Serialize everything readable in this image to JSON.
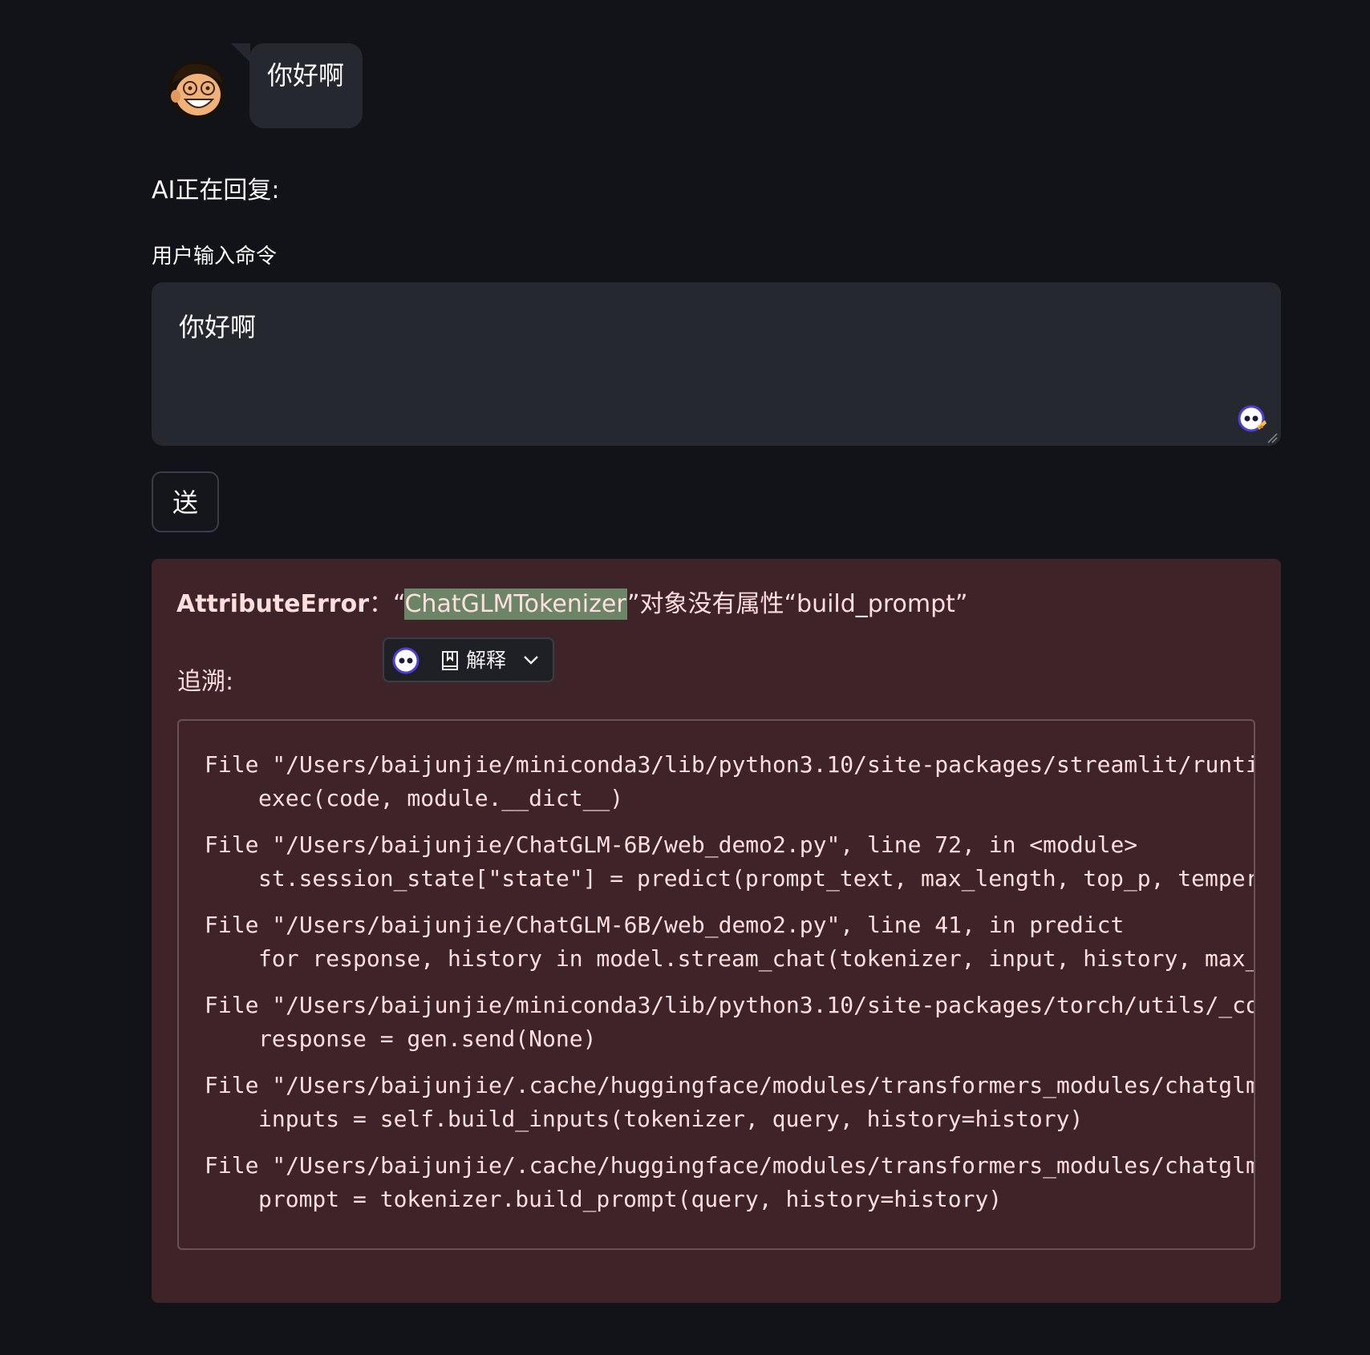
{
  "chat": {
    "user_message": "你好啊"
  },
  "status": {
    "text": "AI正在回复:"
  },
  "input": {
    "label": "用户输入命令",
    "value": "你好啊"
  },
  "send_button": {
    "label": "送"
  },
  "error": {
    "type": "AttributeError",
    "separator": "：“",
    "highlighted_term": "ChatGLMTokenizer",
    "message_rest": "”对象没有属性“build_prompt”",
    "traceback_label": "追溯:",
    "frames": [
      {
        "file_line": "File \"/Users/baijunjie/miniconda3/lib/python3.10/site-packages/streamlit/runti",
        "code": "exec(code, module.__dict__)"
      },
      {
        "file_line": "File \"/Users/baijunjie/ChatGLM-6B/web_demo2.py\", line 72, in <module>",
        "code": "st.session_state[\"state\"] = predict(prompt_text, max_length, top_p, temper"
      },
      {
        "file_line": "File \"/Users/baijunjie/ChatGLM-6B/web_demo2.py\", line 41, in predict",
        "code": "for response, history in model.stream_chat(tokenizer, input, history, max_"
      },
      {
        "file_line": "File \"/Users/baijunjie/miniconda3/lib/python3.10/site-packages/torch/utils/_co",
        "code": "response = gen.send(None)"
      },
      {
        "file_line": "File \"/Users/baijunjie/.cache/huggingface/modules/transformers_modules/chatglm",
        "code": "inputs = self.build_inputs(tokenizer, query, history=history)"
      },
      {
        "file_line": "File \"/Users/baijunjie/.cache/huggingface/modules/transformers_modules/chatglm",
        "code": "prompt = tokenizer.build_prompt(query, history=history)"
      }
    ]
  },
  "explain_popup": {
    "label": "解释",
    "icons": [
      "assistant-bot-icon",
      "book-icon",
      "chevron-down-icon"
    ]
  },
  "colors": {
    "page_background": "#111318",
    "bubble_background": "#262830",
    "error_background": "#3e2329",
    "error_text": "#ffdee0",
    "highlight": "#6b8566"
  }
}
